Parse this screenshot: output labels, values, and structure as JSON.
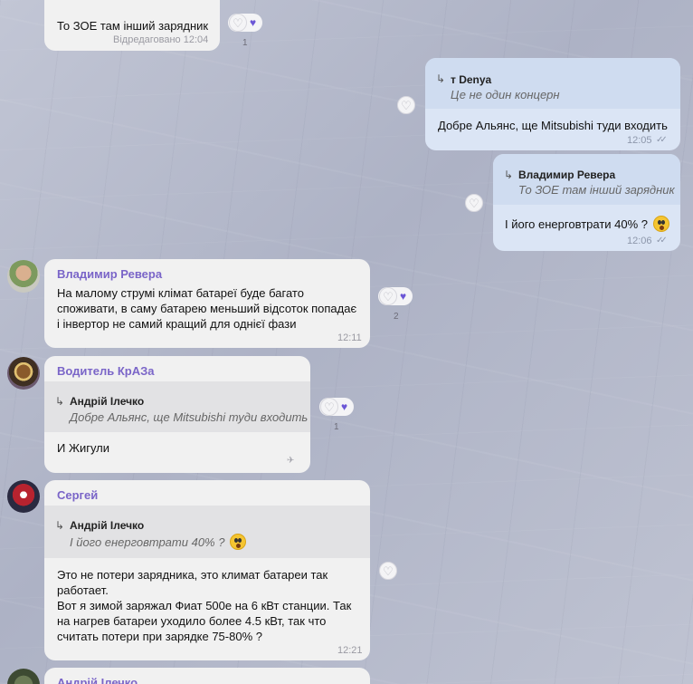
{
  "messages": {
    "m1": {
      "text": "То ЗОЕ там інший зарядник",
      "edited": "Відредаговано 12:04",
      "reaction_count": "1"
    },
    "m2": {
      "quote_author": "т Denya",
      "quote_text": "Це не один концерн",
      "text": "Добре Альянс, ще Mitsubishi туди входить",
      "time": "12:05"
    },
    "m3": {
      "quote_author": "Владимир Ревера",
      "quote_text": "То ЗОЕ там інший зарядник",
      "text": "І його енерговтрати 40% ?",
      "time": "12:06"
    },
    "m4": {
      "sender": "Владимир Ревера",
      "lines": [
        "На малому струмі клімат батареї буде багато",
        "споживати, в саму батарею меньший відсоток попадає",
        "і інвертор не самий кращий для однієї фази"
      ],
      "time": "12:11",
      "reaction_count": "2"
    },
    "m5": {
      "sender": "Водитель КрАЗа",
      "quote_author": "Андрій Ілечко",
      "quote_text": "Добре Альянс, ще Mitsubishi туди входить",
      "text": "И Жигули",
      "reaction_count": "1"
    },
    "m6": {
      "sender": "Сергей",
      "quote_author": "Андрій Ілечко",
      "quote_text": "І його енерговтрати 40% ?",
      "lines": [
        "Это не потери зарядника, это климат батареи так",
        "работает.",
        "Вот я зимой заряжал Фиат 500е на 6 кВт станции. Так",
        "на нагрев батареи уходило более 4.5 кВт, так что",
        "считать потери при зарядке 75-80% ?"
      ],
      "time": "12:21"
    },
    "m7": {
      "sender_partial": "Андрій Ілечко"
    }
  },
  "icons": {
    "reply": "reply-arrow-icon",
    "heart": "heart-icon",
    "read": "double-check-icon",
    "sent": "single-check-icon",
    "emoji": "shocked-face-emoji"
  },
  "colors": {
    "accent": "#7a65c8",
    "heart_filled": "#6b56d6",
    "outgoing_bubble": "#dbe5f5",
    "incoming_bubble": "#f1f1f1"
  }
}
